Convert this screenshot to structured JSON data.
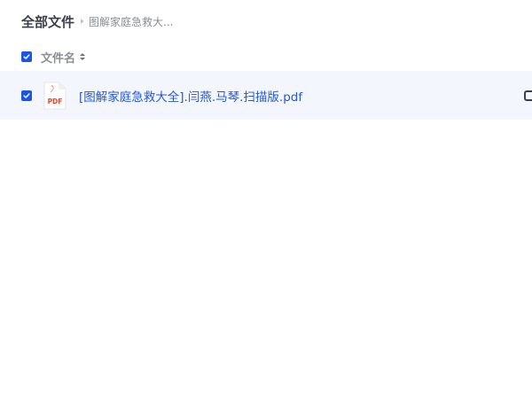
{
  "breadcrumb": {
    "root": "全部文件",
    "current": "图解家庭急救大..."
  },
  "list_header": {
    "column_name": "文件名",
    "select_all_checked": true
  },
  "files": [
    {
      "name": "[图解家庭急救大全].闫燕.马琴.扫描版.pdf",
      "icon_label": "PDF",
      "checked": true
    }
  ],
  "colors": {
    "accent": "#1a56e6",
    "link": "#2257d9",
    "selected_row_bg": "#f4f6fd",
    "pdf_red": "#e2462f"
  },
  "icons": {
    "checkbox": "checkmark-icon",
    "sort": "sort-icon",
    "file": "pdf-file-icon",
    "action": "share-icon"
  }
}
